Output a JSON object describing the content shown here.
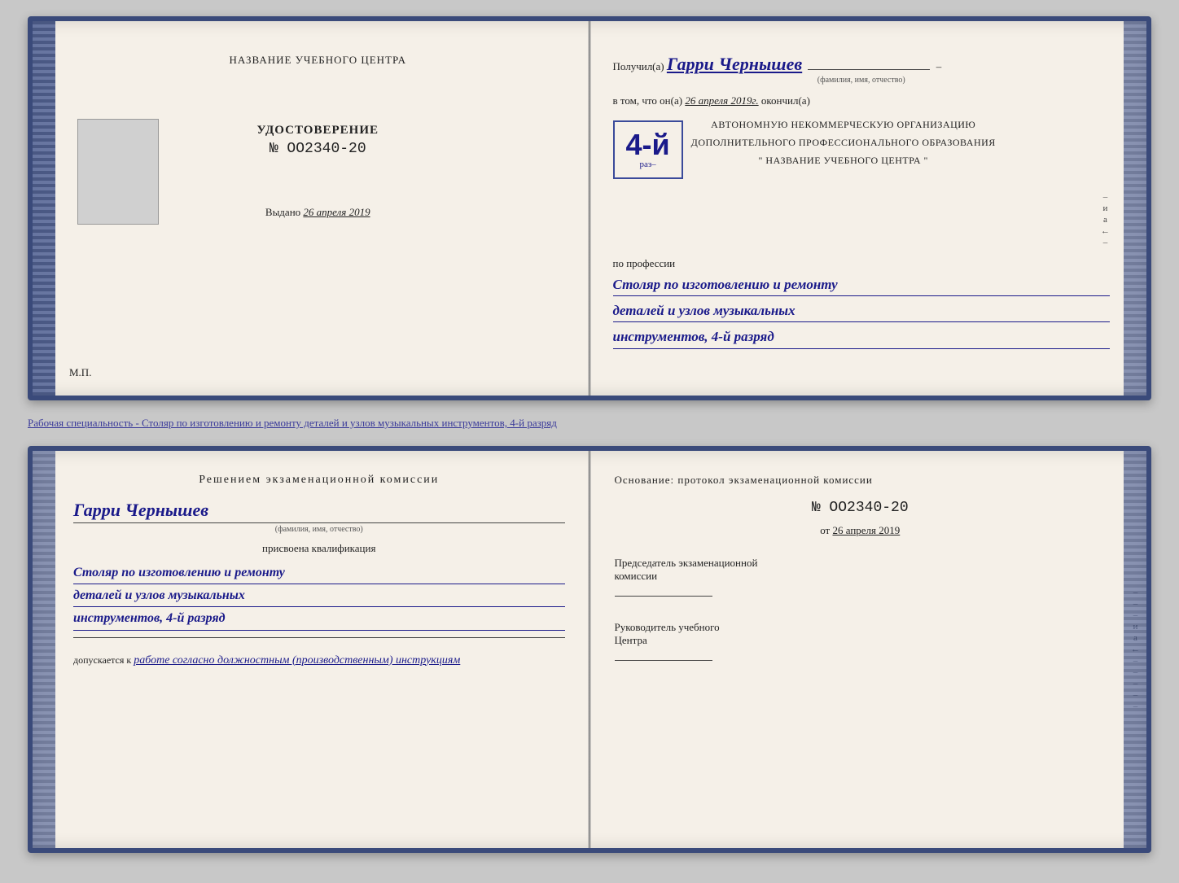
{
  "top_document": {
    "left_page": {
      "header": "НАЗВАНИЕ УЧЕБНОГО ЦЕНТРА",
      "udostoverenie": "УДОСТОВЕРЕНИЕ",
      "number": "№ OO2340-20",
      "vydano_label": "Выдано",
      "vydano_date": "26 апреля 2019",
      "mp": "М.П."
    },
    "right_page": {
      "poluchil": "Получил(а)",
      "name": "Гарри Чернышев",
      "fio_sub": "(фамилия, имя, отчество)",
      "vtom": "в том, что он(а)",
      "vtom_date": "26 апреля 2019г.",
      "okonchil": "окончил(а)",
      "rank": "4-й",
      "rank_sub": "раз–",
      "org_line1": "АВТОНОМНУЮ НЕКОММЕРЧЕСКУЮ ОРГАНИЗАЦИЮ",
      "org_line2": "ДОПОЛНИТЕЛЬНОГО ПРОФЕССИОНАЛЬНОГО ОБРАЗОВАНИЯ",
      "org_line3": "\" НАЗВАНИЕ УЧЕБНОГО ЦЕНТРА \"",
      "po_professii": "по профессии",
      "profession_line1": "Столяр по изготовлению и ремонту",
      "profession_line2": "деталей и узлов музыкальных",
      "profession_line3": "инструментов, 4-й разряд"
    }
  },
  "description": "Рабочая специальность - Столяр по изготовлению и ремонту деталей и узлов музыкальных инструментов, 4-й разряд",
  "bottom_document": {
    "left_page": {
      "resheniem": "Решением экзаменационной комиссии",
      "name": "Гарри Чернышев",
      "fio_sub": "(фамилия, имя, отчество)",
      "prisvoena": "присвоена квалификация",
      "qual_line1": "Столяр по изготовлению и ремонту",
      "qual_line2": "деталей и узлов музыкальных",
      "qual_line3": "инструментов, 4-й разряд",
      "dopuskaetsya": "допускается к",
      "dopusk_text": "работе согласно должностным (производственным) инструкциям"
    },
    "right_page": {
      "osnovanie": "Основание: протокол экзаменационной комиссии",
      "number": "№ OO2340-20",
      "ot_label": "от",
      "ot_date": "26 апреля 2019",
      "predsedatel_line1": "Председатель экзаменационной",
      "predsedatel_line2": "комиссии",
      "rukovoditel_line1": "Руководитель учебного",
      "rukovoditel_line2": "Центра"
    },
    "side_letters": [
      "и",
      "а",
      "←",
      "–",
      "–",
      "–",
      "–",
      "–"
    ]
  }
}
